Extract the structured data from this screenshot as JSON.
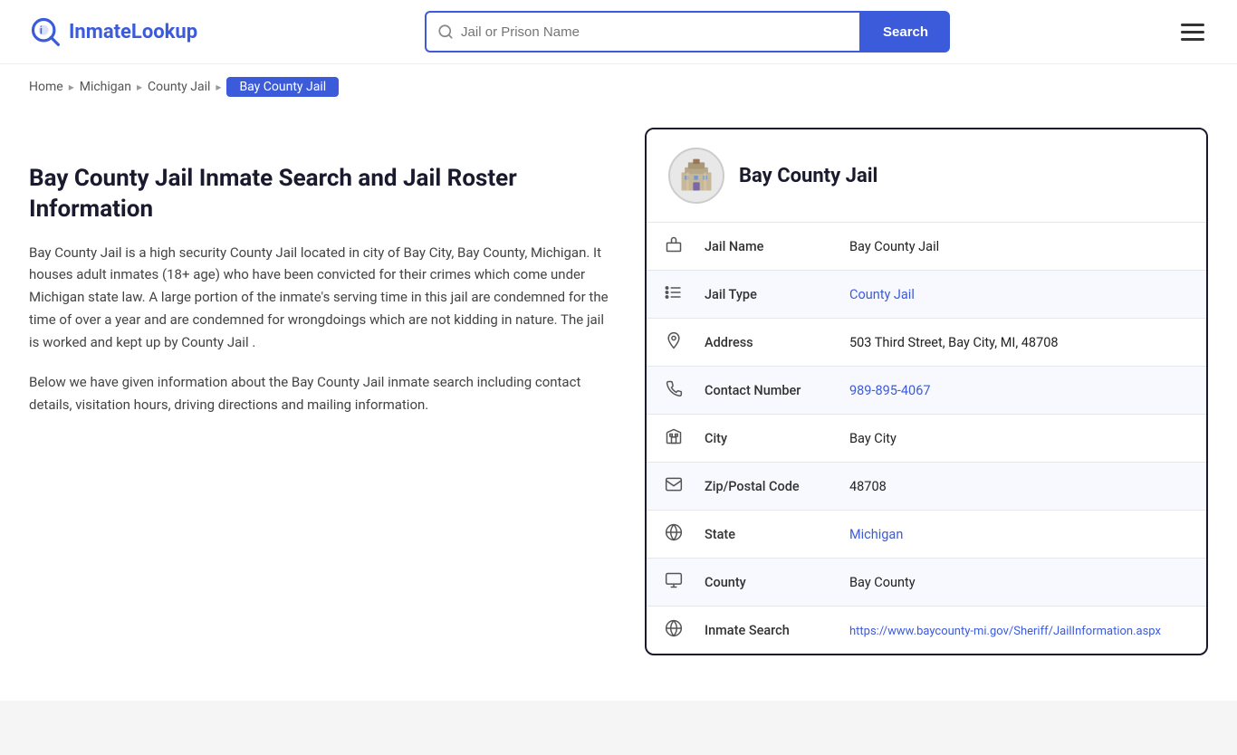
{
  "header": {
    "logo_brand": "InmateLookup",
    "logo_brand_highlight": "Inmate",
    "search_placeholder": "Jail or Prison Name",
    "search_button_label": "Search"
  },
  "breadcrumb": {
    "items": [
      {
        "label": "Home",
        "href": "#"
      },
      {
        "label": "Michigan",
        "href": "#"
      },
      {
        "label": "County Jail",
        "href": "#"
      }
    ],
    "active": "Bay County Jail"
  },
  "left": {
    "page_title": "Bay County Jail Inmate Search and Jail Roster Information",
    "description_1": "Bay County Jail is a high security County Jail located in city of Bay City, Bay County, Michigan. It houses adult inmates (18+ age) who have been convicted for their crimes which come under Michigan state law. A large portion of the inmate's serving time in this jail are condemned for the time of over a year and are condemned for wrongdoings which are not kidding in nature. The jail is worked and kept up by County Jail .",
    "description_2": "Below we have given information about the Bay County Jail inmate search including contact details, visitation hours, driving directions and mailing information."
  },
  "card": {
    "jail_name_heading": "Bay County Jail",
    "rows": [
      {
        "icon": "jail-icon",
        "label": "Jail Name",
        "value": "Bay County Jail",
        "link": false
      },
      {
        "icon": "list-icon",
        "label": "Jail Type",
        "value": "County Jail",
        "link": true,
        "href": "#"
      },
      {
        "icon": "location-icon",
        "label": "Address",
        "value": "503 Third Street, Bay City, MI, 48708",
        "link": false
      },
      {
        "icon": "phone-icon",
        "label": "Contact Number",
        "value": "989-895-4067",
        "link": true,
        "href": "tel:989-895-4067"
      },
      {
        "icon": "city-icon",
        "label": "City",
        "value": "Bay City",
        "link": false
      },
      {
        "icon": "mail-icon",
        "label": "Zip/Postal Code",
        "value": "48708",
        "link": false
      },
      {
        "icon": "globe-icon",
        "label": "State",
        "value": "Michigan",
        "link": true,
        "href": "#"
      },
      {
        "icon": "county-icon",
        "label": "County",
        "value": "Bay County",
        "link": false
      },
      {
        "icon": "search-globe-icon",
        "label": "Inmate Search",
        "value": "https://www.baycounty-mi.gov/Sheriff/JailInformation.aspx",
        "link": true,
        "href": "https://www.baycounty-mi.gov/Sheriff/JailInformation.aspx"
      }
    ]
  }
}
